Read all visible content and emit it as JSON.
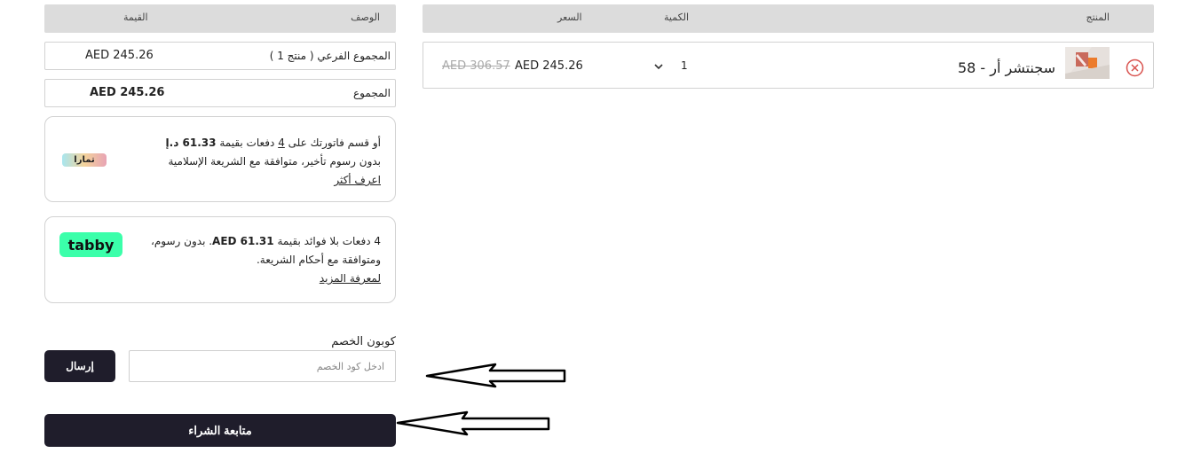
{
  "cart_table": {
    "headers": {
      "product": "المنتج",
      "quantity": "الكمية",
      "price": "السعر"
    },
    "items": [
      {
        "name": "سجنتشر أر - 58",
        "quantity": "1",
        "price": "AED 245.26",
        "old_price": "AED 306.57"
      }
    ]
  },
  "summary": {
    "headers": {
      "description": "الوصف",
      "value": "القيمة"
    },
    "subtotal_label": "المجموع الفرعي ( منتج 1 )",
    "subtotal_value": "AED 245.26",
    "total_label": "المجموع",
    "total_value": "AED 245.26"
  },
  "tamara": {
    "line1_prefix": "أو قسم فاتورتك على",
    "installments": "4",
    "line1_mid": "دفعات بقيمة",
    "amount": "61.33 د.إ",
    "line2": "بدون رسوم تأخير، متوافقة مع الشريعة الإسلامية",
    "link": "اعرف أكثر",
    "logo_text": "تمارا"
  },
  "tabby": {
    "prefix": "4 دفعات بلا فوائد بقيمة",
    "amount": "AED 61.31",
    "suffix": ". بدون رسوم، ومتوافقة مع أحكام الشريعة.",
    "link": "لمعرفة المزيد",
    "logo_text": "tabby"
  },
  "coupon": {
    "label": "كوبون الخصم",
    "placeholder": "ادخل كود الخصم",
    "submit_label": "إرسال"
  },
  "checkout": {
    "label": "متابعة الشراء"
  },
  "colors": {
    "dark_button": "#1f1d2b",
    "header_bg": "#dcdcdc",
    "remove_red": "#d9534f",
    "tabby_green": "#3bffaa"
  }
}
